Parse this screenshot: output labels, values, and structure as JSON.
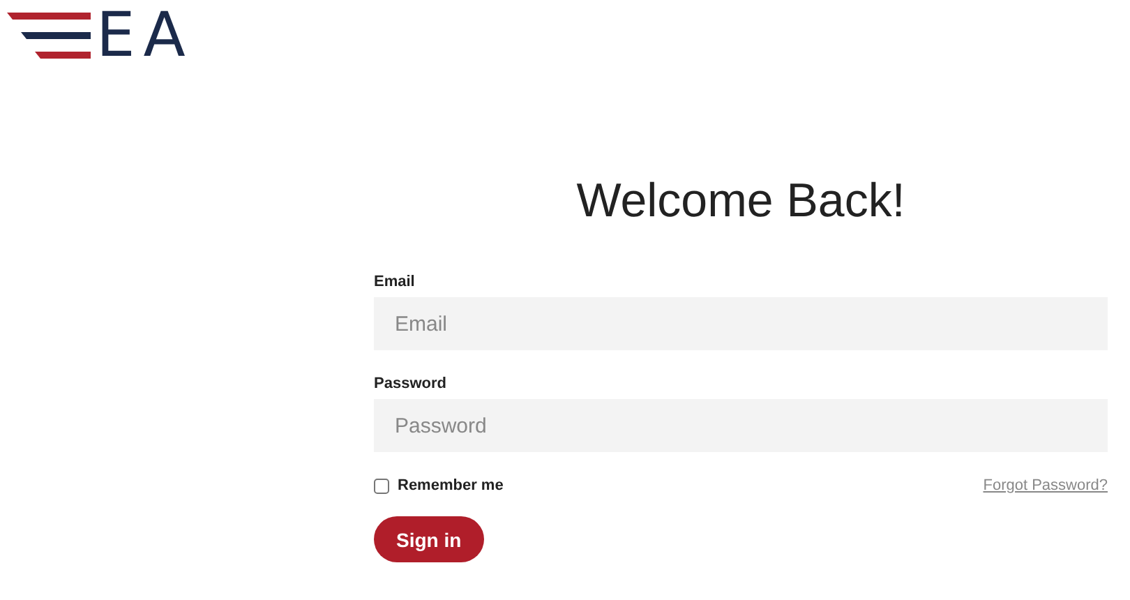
{
  "logo": {
    "text": "EA"
  },
  "title": "Welcome Back!",
  "fields": [
    {
      "label": "Email",
      "placeholder": "Email"
    },
    {
      "label": "Password",
      "placeholder": "Password"
    }
  ],
  "remember": {
    "label": "Remember me",
    "checked": false
  },
  "forgot_link": "Forgot Password?",
  "submit": "Sign in"
}
